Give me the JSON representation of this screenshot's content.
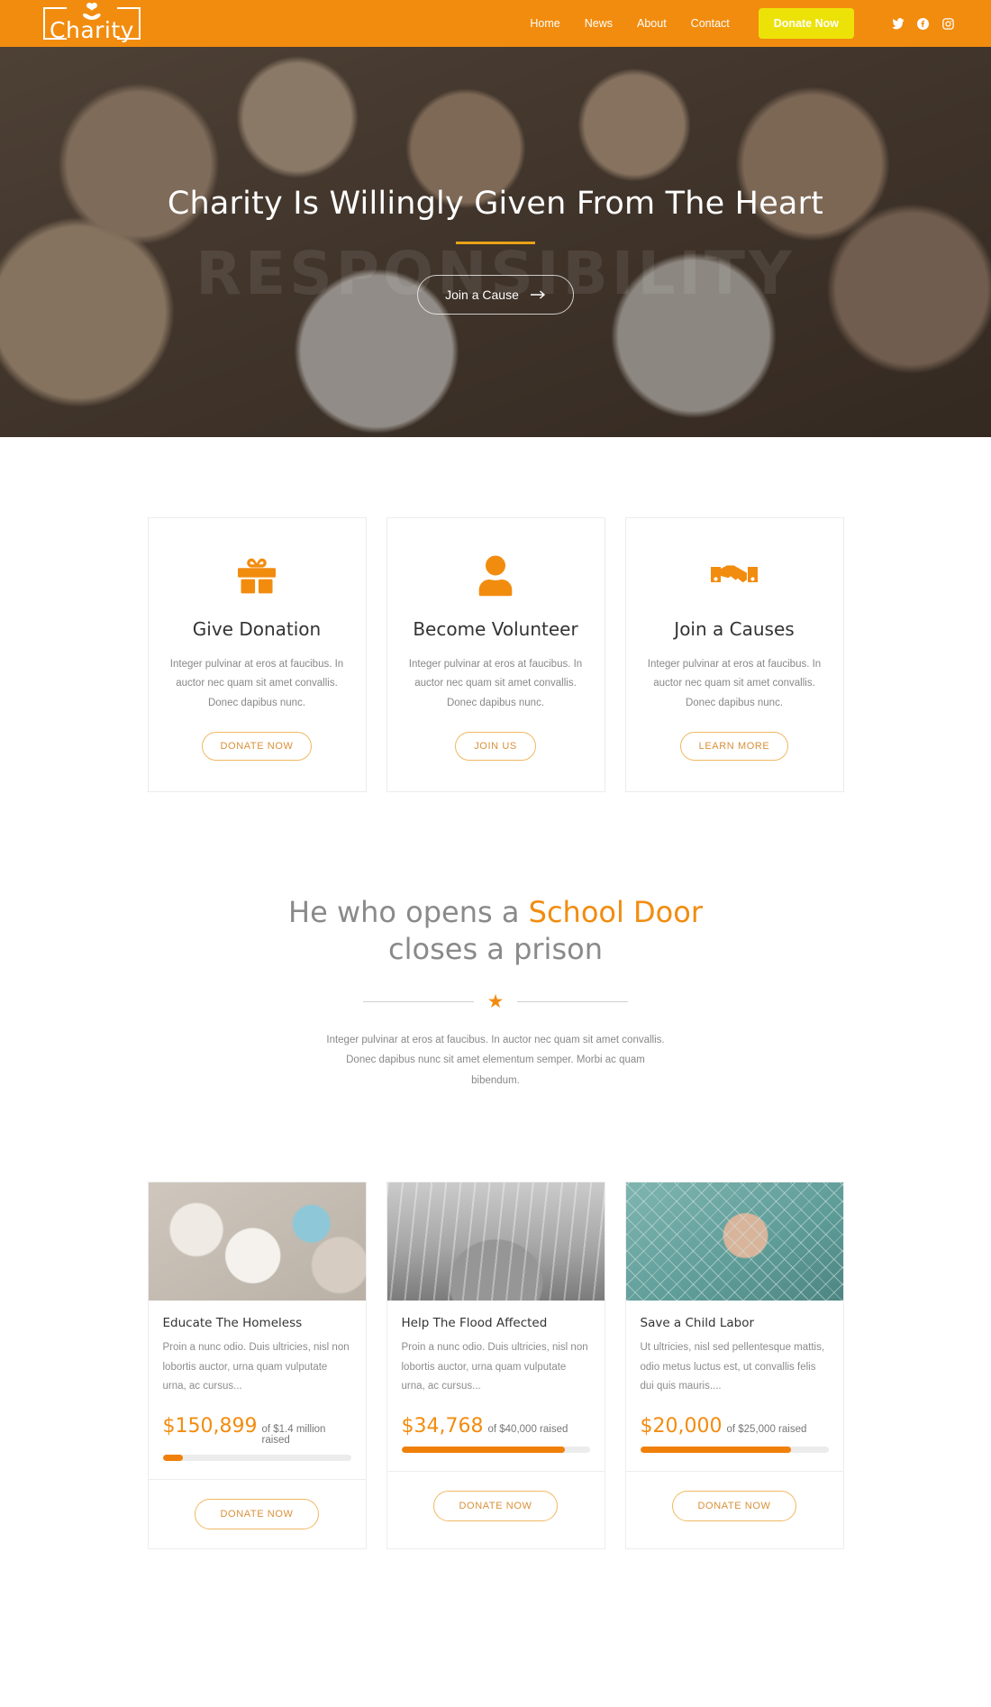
{
  "header": {
    "logo_text": "Charity",
    "logo_icon": "heart-in-hand-icon",
    "nav": [
      {
        "label": "Home"
      },
      {
        "label": "News"
      },
      {
        "label": "About"
      },
      {
        "label": "Contact"
      }
    ],
    "donate_label": "Donate Now",
    "socials": [
      {
        "name": "twitter-icon"
      },
      {
        "name": "facebook-icon"
      },
      {
        "name": "instagram-icon"
      }
    ],
    "colors": {
      "bar": "#F28C0F",
      "donate": "#EDE208"
    }
  },
  "hero": {
    "watermark": "RESPONSIBILITY",
    "title": "Charity Is Willingly Given From The Heart",
    "cta_label": "Join a Cause",
    "cta_icon": "arrow-right-icon",
    "rule_color": "#E8A317"
  },
  "services": [
    {
      "icon": "gift-icon",
      "title": "Give Donation",
      "text": "Integer pulvinar at eros at faucibus. In auctor nec quam sit amet convallis. Donec dapibus nunc.",
      "button": "DONATE NOW"
    },
    {
      "icon": "person-icon",
      "title": "Become Volunteer",
      "text": "Integer pulvinar at eros at faucibus. In auctor nec quam sit amet convallis. Donec dapibus nunc.",
      "button": "JOIN US"
    },
    {
      "icon": "handshake-icon",
      "title": "Join a Causes",
      "text": "Integer pulvinar at eros at faucibus. In auctor nec quam sit amet convallis. Donec dapibus nunc.",
      "button": "LEARN MORE"
    }
  ],
  "quote": {
    "line1_a": "He who opens a ",
    "line1_hl": "School Door",
    "line2": "closes a prison",
    "star_icon": "star-icon",
    "paragraph": "Integer pulvinar at eros at faucibus. In auctor nec quam sit amet convallis. Donec dapibus nunc sit amet elementum semper. Morbi ac quam bibendum.",
    "highlight_color": "#F28C0F"
  },
  "campaigns": [
    {
      "image": "children-in-classroom-photo",
      "title": "Educate The Homeless",
      "text": "Proin a nunc odio. Duis ultricies, nisl non lobortis auctor, urna quam vulputate urna, ac cursus...",
      "amount": "$150,899",
      "goal_text": "of $1.4 million raised",
      "progress": 11,
      "button": "DONATE NOW"
    },
    {
      "image": "flooded-dead-forest-photo",
      "title": "Help The Flood Affected",
      "text": "Proin a nunc odio. Duis ultricies, nisl non lobortis auctor, urna quam vulputate urna, ac cursus...",
      "amount": "$34,768",
      "goal_text": "of $40,000 raised",
      "progress": 87,
      "button": "DONATE NOW"
    },
    {
      "image": "child-behind-fence-photo",
      "title": "Save a Child Labor",
      "text": "Ut ultricies, nisl sed pellentesque mattis, odio metus luctus est, ut convallis felis dui quis mauris....",
      "amount": "$20,000",
      "goal_text": "of $25,000 raised",
      "progress": 80,
      "button": "DONATE NOW"
    }
  ]
}
